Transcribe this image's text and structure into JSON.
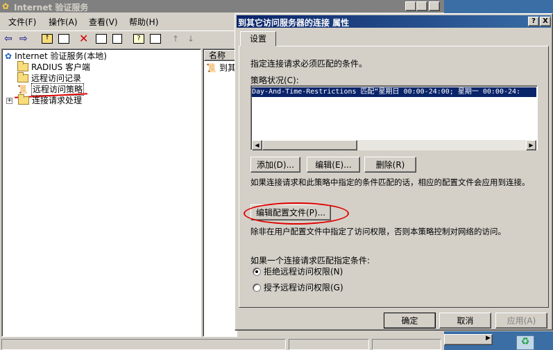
{
  "main_window": {
    "title": "Internet 验证服务",
    "menu": [
      "文件(F)",
      "操作(A)",
      "查看(V)",
      "帮助(H)"
    ],
    "tree": {
      "root": "Internet 验证服务(本地)",
      "items": [
        "RADIUS 客户端",
        "远程访问记录",
        "远程访问策略",
        "连接请求处理"
      ]
    },
    "list_header": "名称",
    "list_item": "到其"
  },
  "dialog": {
    "title": "到其它访问服务器的连接 属性",
    "help_btn": "?",
    "close_btn": "X",
    "tab": "设置",
    "intro": "指定连接请求必须匹配的条件。",
    "policy_label": "策略状况(C):",
    "policy_line": "Day-And-Time-Restrictions 匹配“星期日 00:00-24:00; 星期一 00:00-24:",
    "add_btn": "添加(D)...",
    "edit_btn": "编辑(E)...",
    "remove_btn": "删除(R)",
    "match_text": "如果连接请求和此策略中指定的条件匹配的话，相应的配置文件会应用到连接。",
    "edit_profile_btn": "编辑配置文件(P)...",
    "profile_text": "除非在用户配置文件中指定了访问权限，否则本策略控制对网络的访问。",
    "cond_label": "如果一个连接请求匹配指定条件:",
    "radio_deny": "拒绝远程访问权限(N)",
    "radio_grant": "授予远程访问权限(G)",
    "ok_btn": "确定",
    "cancel_btn": "取消",
    "apply_btn": "应用(A)"
  },
  "colors": {
    "annotation_red": "#e00000",
    "selection_blue": "#0a246a"
  }
}
